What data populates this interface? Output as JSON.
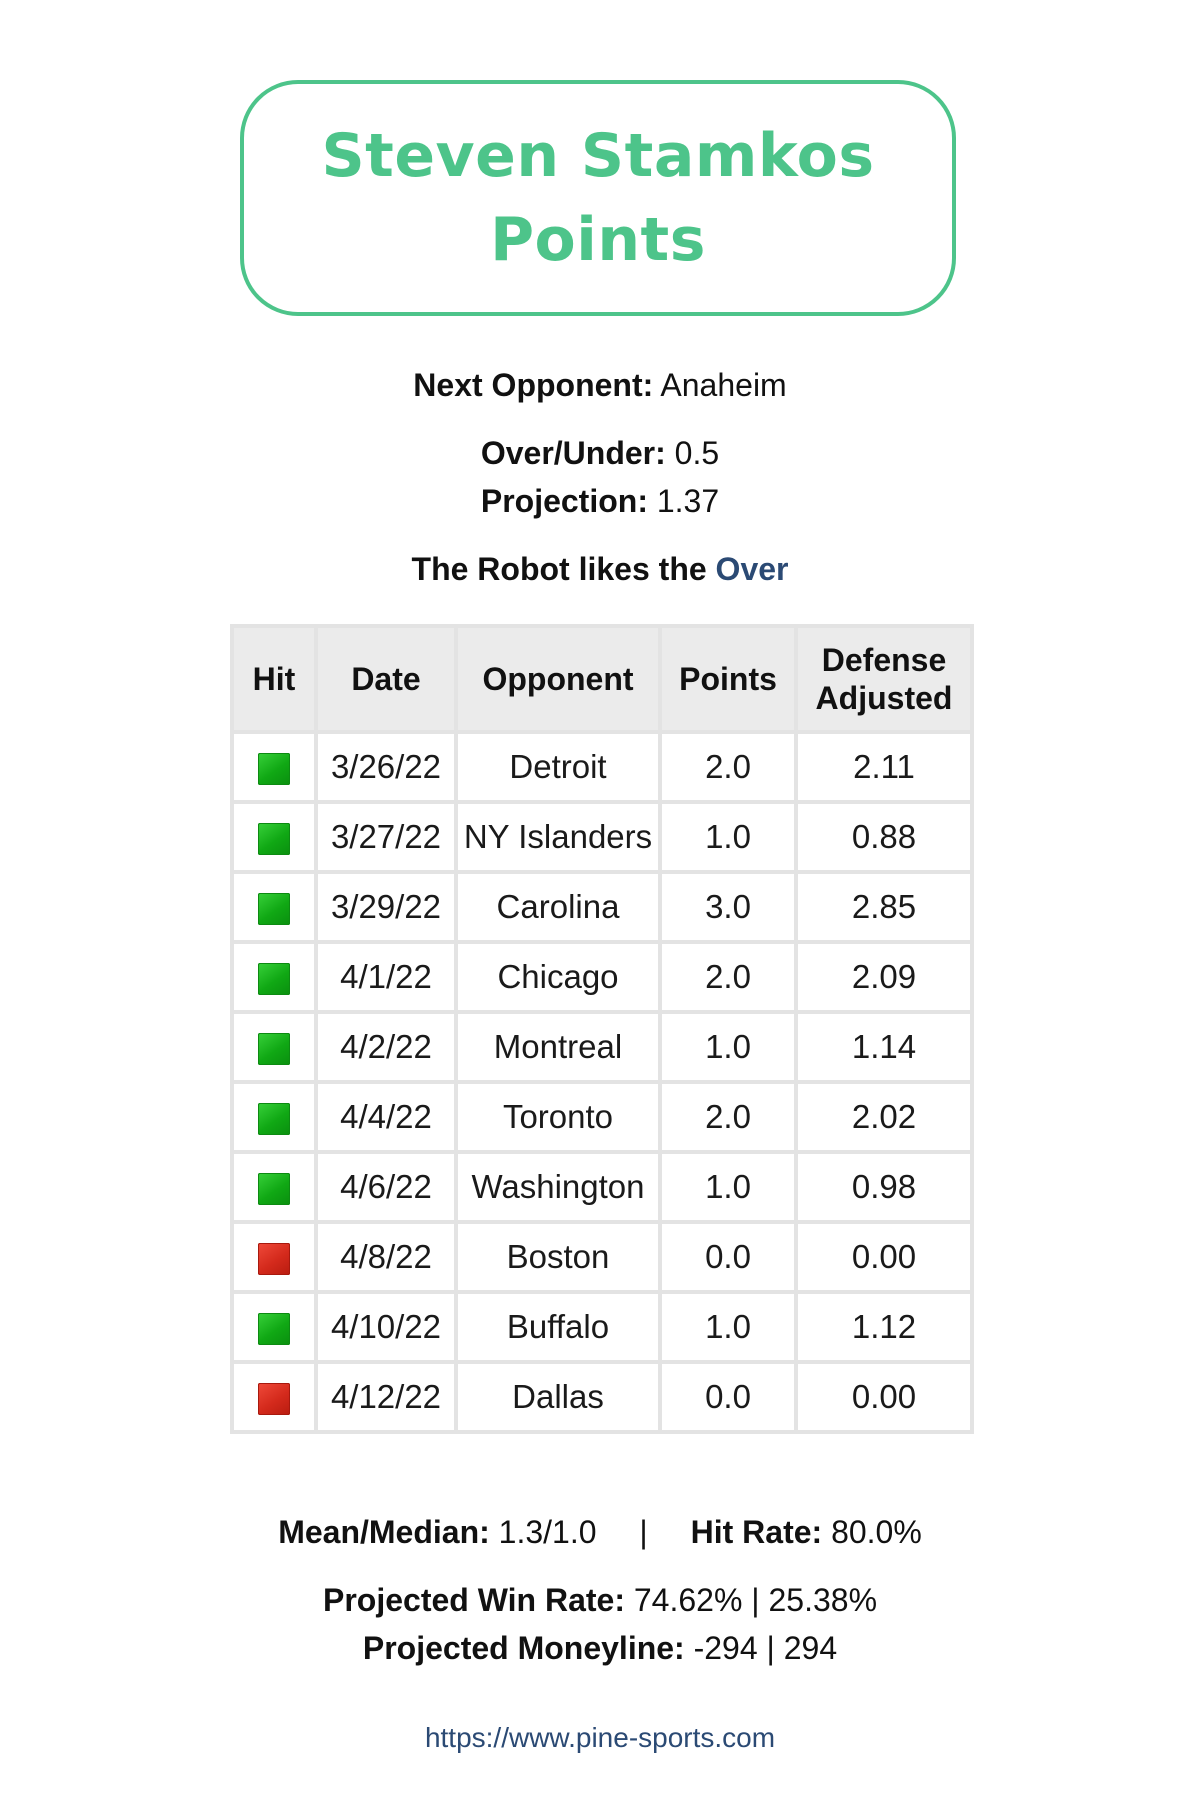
{
  "title": {
    "line1": "Steven Stamkos",
    "line2": "Points"
  },
  "next_opponent": {
    "label": "Next Opponent:",
    "value": "Anaheim"
  },
  "over_under": {
    "label": "Over/Under:",
    "value": "0.5"
  },
  "projection": {
    "label": "Projection:",
    "value": "1.37"
  },
  "robot_pick": {
    "prefix": "The Robot likes the",
    "pick": "Over"
  },
  "table": {
    "headers": {
      "hit": "Hit",
      "date": "Date",
      "opponent": "Opponent",
      "points": "Points",
      "defense_line1": "Defense",
      "defense_line2": "Adjusted"
    },
    "rows": [
      {
        "hit": "hit",
        "date": "3/26/22",
        "opponent": "Detroit",
        "points": "2.0",
        "defense_adjusted": "2.11"
      },
      {
        "hit": "hit",
        "date": "3/27/22",
        "opponent": "NY Islanders",
        "points": "1.0",
        "defense_adjusted": "0.88"
      },
      {
        "hit": "hit",
        "date": "3/29/22",
        "opponent": "Carolina",
        "points": "3.0",
        "defense_adjusted": "2.85"
      },
      {
        "hit": "hit",
        "date": "4/1/22",
        "opponent": "Chicago",
        "points": "2.0",
        "defense_adjusted": "2.09"
      },
      {
        "hit": "hit",
        "date": "4/2/22",
        "opponent": "Montreal",
        "points": "1.0",
        "defense_adjusted": "1.14"
      },
      {
        "hit": "hit",
        "date": "4/4/22",
        "opponent": "Toronto",
        "points": "2.0",
        "defense_adjusted": "2.02"
      },
      {
        "hit": "hit",
        "date": "4/6/22",
        "opponent": "Washington",
        "points": "1.0",
        "defense_adjusted": "0.98"
      },
      {
        "hit": "miss",
        "date": "4/8/22",
        "opponent": "Boston",
        "points": "0.0",
        "defense_adjusted": "0.00"
      },
      {
        "hit": "hit",
        "date": "4/10/22",
        "opponent": "Buffalo",
        "points": "1.0",
        "defense_adjusted": "1.12"
      },
      {
        "hit": "miss",
        "date": "4/12/22",
        "opponent": "Dallas",
        "points": "0.0",
        "defense_adjusted": "0.00"
      }
    ]
  },
  "summary": {
    "mean_median_label": "Mean/Median:",
    "mean_median_value": "1.3/1.0",
    "separator": "|",
    "hit_rate_label": "Hit Rate:",
    "hit_rate_value": "80.0%"
  },
  "projected": {
    "win_rate_label": "Projected Win Rate:",
    "win_rate_value": "74.62% | 25.38%",
    "moneyline_label": "Projected Moneyline:",
    "moneyline_value": "-294 | 294"
  },
  "footer": {
    "url": "https://www.pine-sports.com"
  },
  "colors": {
    "accent_green": "#4dc48a",
    "over_blue": "#2b4a74",
    "hit_green": "#10a814",
    "miss_red": "#d42a1c"
  }
}
